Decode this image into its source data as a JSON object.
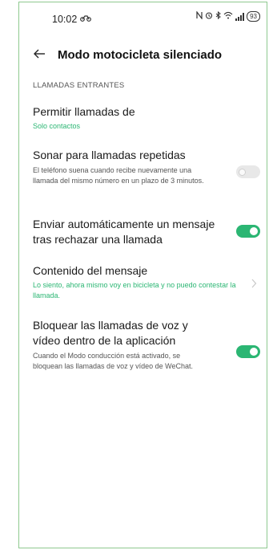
{
  "status_bar": {
    "time": "10:02",
    "activity_icon": "motorcycle-icon",
    "icons": [
      "nfc-icon",
      "alarm-icon",
      "bluetooth-icon",
      "wifi-icon",
      "signal-icon"
    ],
    "battery": "93"
  },
  "header": {
    "title": "Modo motocicleta silenciado"
  },
  "section": {
    "label": "LLAMADAS ENTRANTES"
  },
  "settings": [
    {
      "title": "Permitir llamadas de",
      "value": "Solo contactos"
    },
    {
      "title": "Sonar para llamadas repetidas",
      "description": "El teléfono suena cuando recibe nuevamente una llamada del mismo número en un plazo de 3 minutos.",
      "toggle": "off"
    },
    {
      "title": "Enviar automáticamente un mensaje tras rechazar una llamada",
      "toggle": "on"
    },
    {
      "title": "Contenido del mensaje",
      "value": "Lo siento, ahora mismo voy en bicicleta y no puedo contestar la llamada."
    },
    {
      "title": "Bloquear las llamadas de voz y vídeo dentro de la aplicación",
      "description": "Cuando el Modo conducción está activado, se bloquean las llamadas de voz y vídeo de WeChat.",
      "toggle": "on"
    }
  ],
  "colors": {
    "accent": "#2bb673",
    "frame_border": "#8fc990",
    "toggle_off": "#e8e8e8"
  }
}
